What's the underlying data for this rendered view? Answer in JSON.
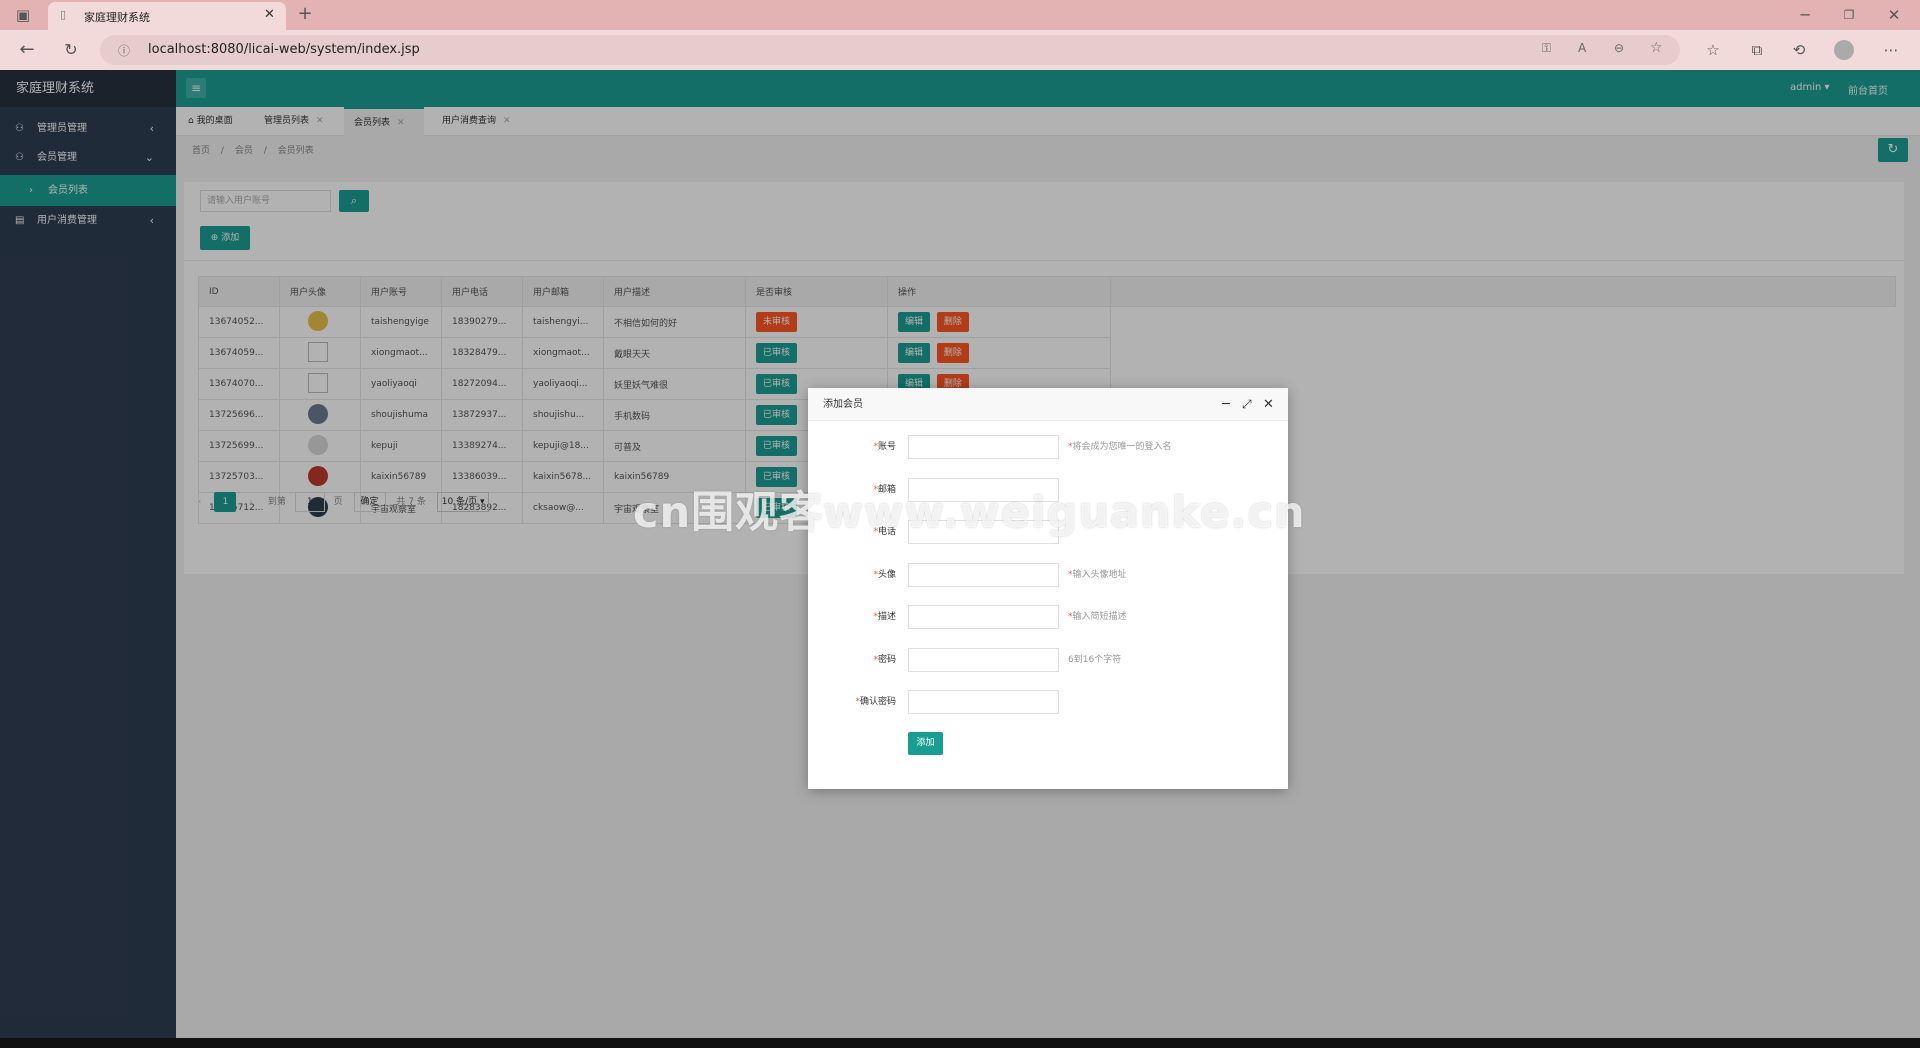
{
  "browser": {
    "tab_title": "家庭理财系统",
    "url": "localhost:8080/licai-web/system/index.jsp"
  },
  "app": {
    "title": "家庭理财系统",
    "user_menu": "admin",
    "front_link": "前台首页"
  },
  "sidebar": {
    "items": [
      {
        "label": "管理员管理"
      },
      {
        "label": "会员管理"
      },
      {
        "label": "会员列表"
      },
      {
        "label": "用户消费管理"
      }
    ]
  },
  "tabs": [
    {
      "label": "我的桌面"
    },
    {
      "label": "管理员列表"
    },
    {
      "label": "会员列表"
    },
    {
      "label": "用户消费查询"
    }
  ],
  "breadcrumb": {
    "home": "首页",
    "sep1": "/",
    "level1": "会员",
    "sep2": "/",
    "current": "会员列表"
  },
  "search": {
    "placeholder": "请输入用户账号",
    "add_label": "添加"
  },
  "table": {
    "headers": [
      "ID",
      "用户头像",
      "用户账号",
      "用户电话",
      "用户邮箱",
      "用户描述",
      "是否审核",
      "操作"
    ],
    "edit_label": "编辑",
    "delete_label": "删除",
    "rows": [
      {
        "id": "13674052...",
        "account": "taishengyige",
        "phone": "18390279...",
        "email": "taishengyi...",
        "desc": "不相信如何的好",
        "status": "未审核",
        "approved": false
      },
      {
        "id": "13674059...",
        "account": "xiongmaot...",
        "phone": "18328479...",
        "email": "xiongmaot...",
        "desc": "戴眼天天",
        "status": "已审核",
        "approved": true
      },
      {
        "id": "13674070...",
        "account": "yaoliyaoqi",
        "phone": "18272094...",
        "email": "yaoliyaoqi...",
        "desc": "妖里妖气难很",
        "status": "已审核",
        "approved": true
      },
      {
        "id": "13725696...",
        "account": "shoujishuma",
        "phone": "13872937...",
        "email": "shoujishu...",
        "desc": "手机数码",
        "status": "已审核",
        "approved": true
      },
      {
        "id": "13725699...",
        "account": "kepuji",
        "phone": "13389274...",
        "email": "kepuji@18...",
        "desc": "可普及",
        "status": "已审核",
        "approved": true
      },
      {
        "id": "13725703...",
        "account": "kaixin56789",
        "phone": "13386039...",
        "email": "kaixin5678...",
        "desc": "kaixin56789",
        "status": "已审核",
        "approved": true
      },
      {
        "id": "13725712...",
        "account": "宇宙观察室",
        "phone": "18283892...",
        "email": "cksaow@...",
        "desc": "宇宙观察室",
        "status": "已审核",
        "approved": true
      }
    ]
  },
  "pagination": {
    "current": "1",
    "goto_label": "到第",
    "page_value": "1",
    "page_unit": "页",
    "confirm": "确定",
    "total": "共 7 条",
    "page_size": "10 条/页"
  },
  "dialog": {
    "title": "添加会员",
    "fields": [
      {
        "label": "账号",
        "hint": "将会成为您唯一的登入名",
        "hint_req": true
      },
      {
        "label": "邮箱",
        "hint": "",
        "hint_req": false
      },
      {
        "label": "电话",
        "hint": "",
        "hint_req": false
      },
      {
        "label": "头像",
        "hint": "输入头像地址",
        "hint_req": true
      },
      {
        "label": "描述",
        "hint": "输入简短描述",
        "hint_req": true
      },
      {
        "label": "密码",
        "hint": "6到16个字符",
        "hint_req": false
      },
      {
        "label": "确认密码",
        "hint": "",
        "hint_req": false
      }
    ],
    "submit_label": "添加"
  },
  "watermark": "cn围观客www.weiguanke.cn",
  "colors": {
    "teal": "#1a9e93",
    "danger": "#ff5722",
    "sidebar": "#2f3e52"
  }
}
